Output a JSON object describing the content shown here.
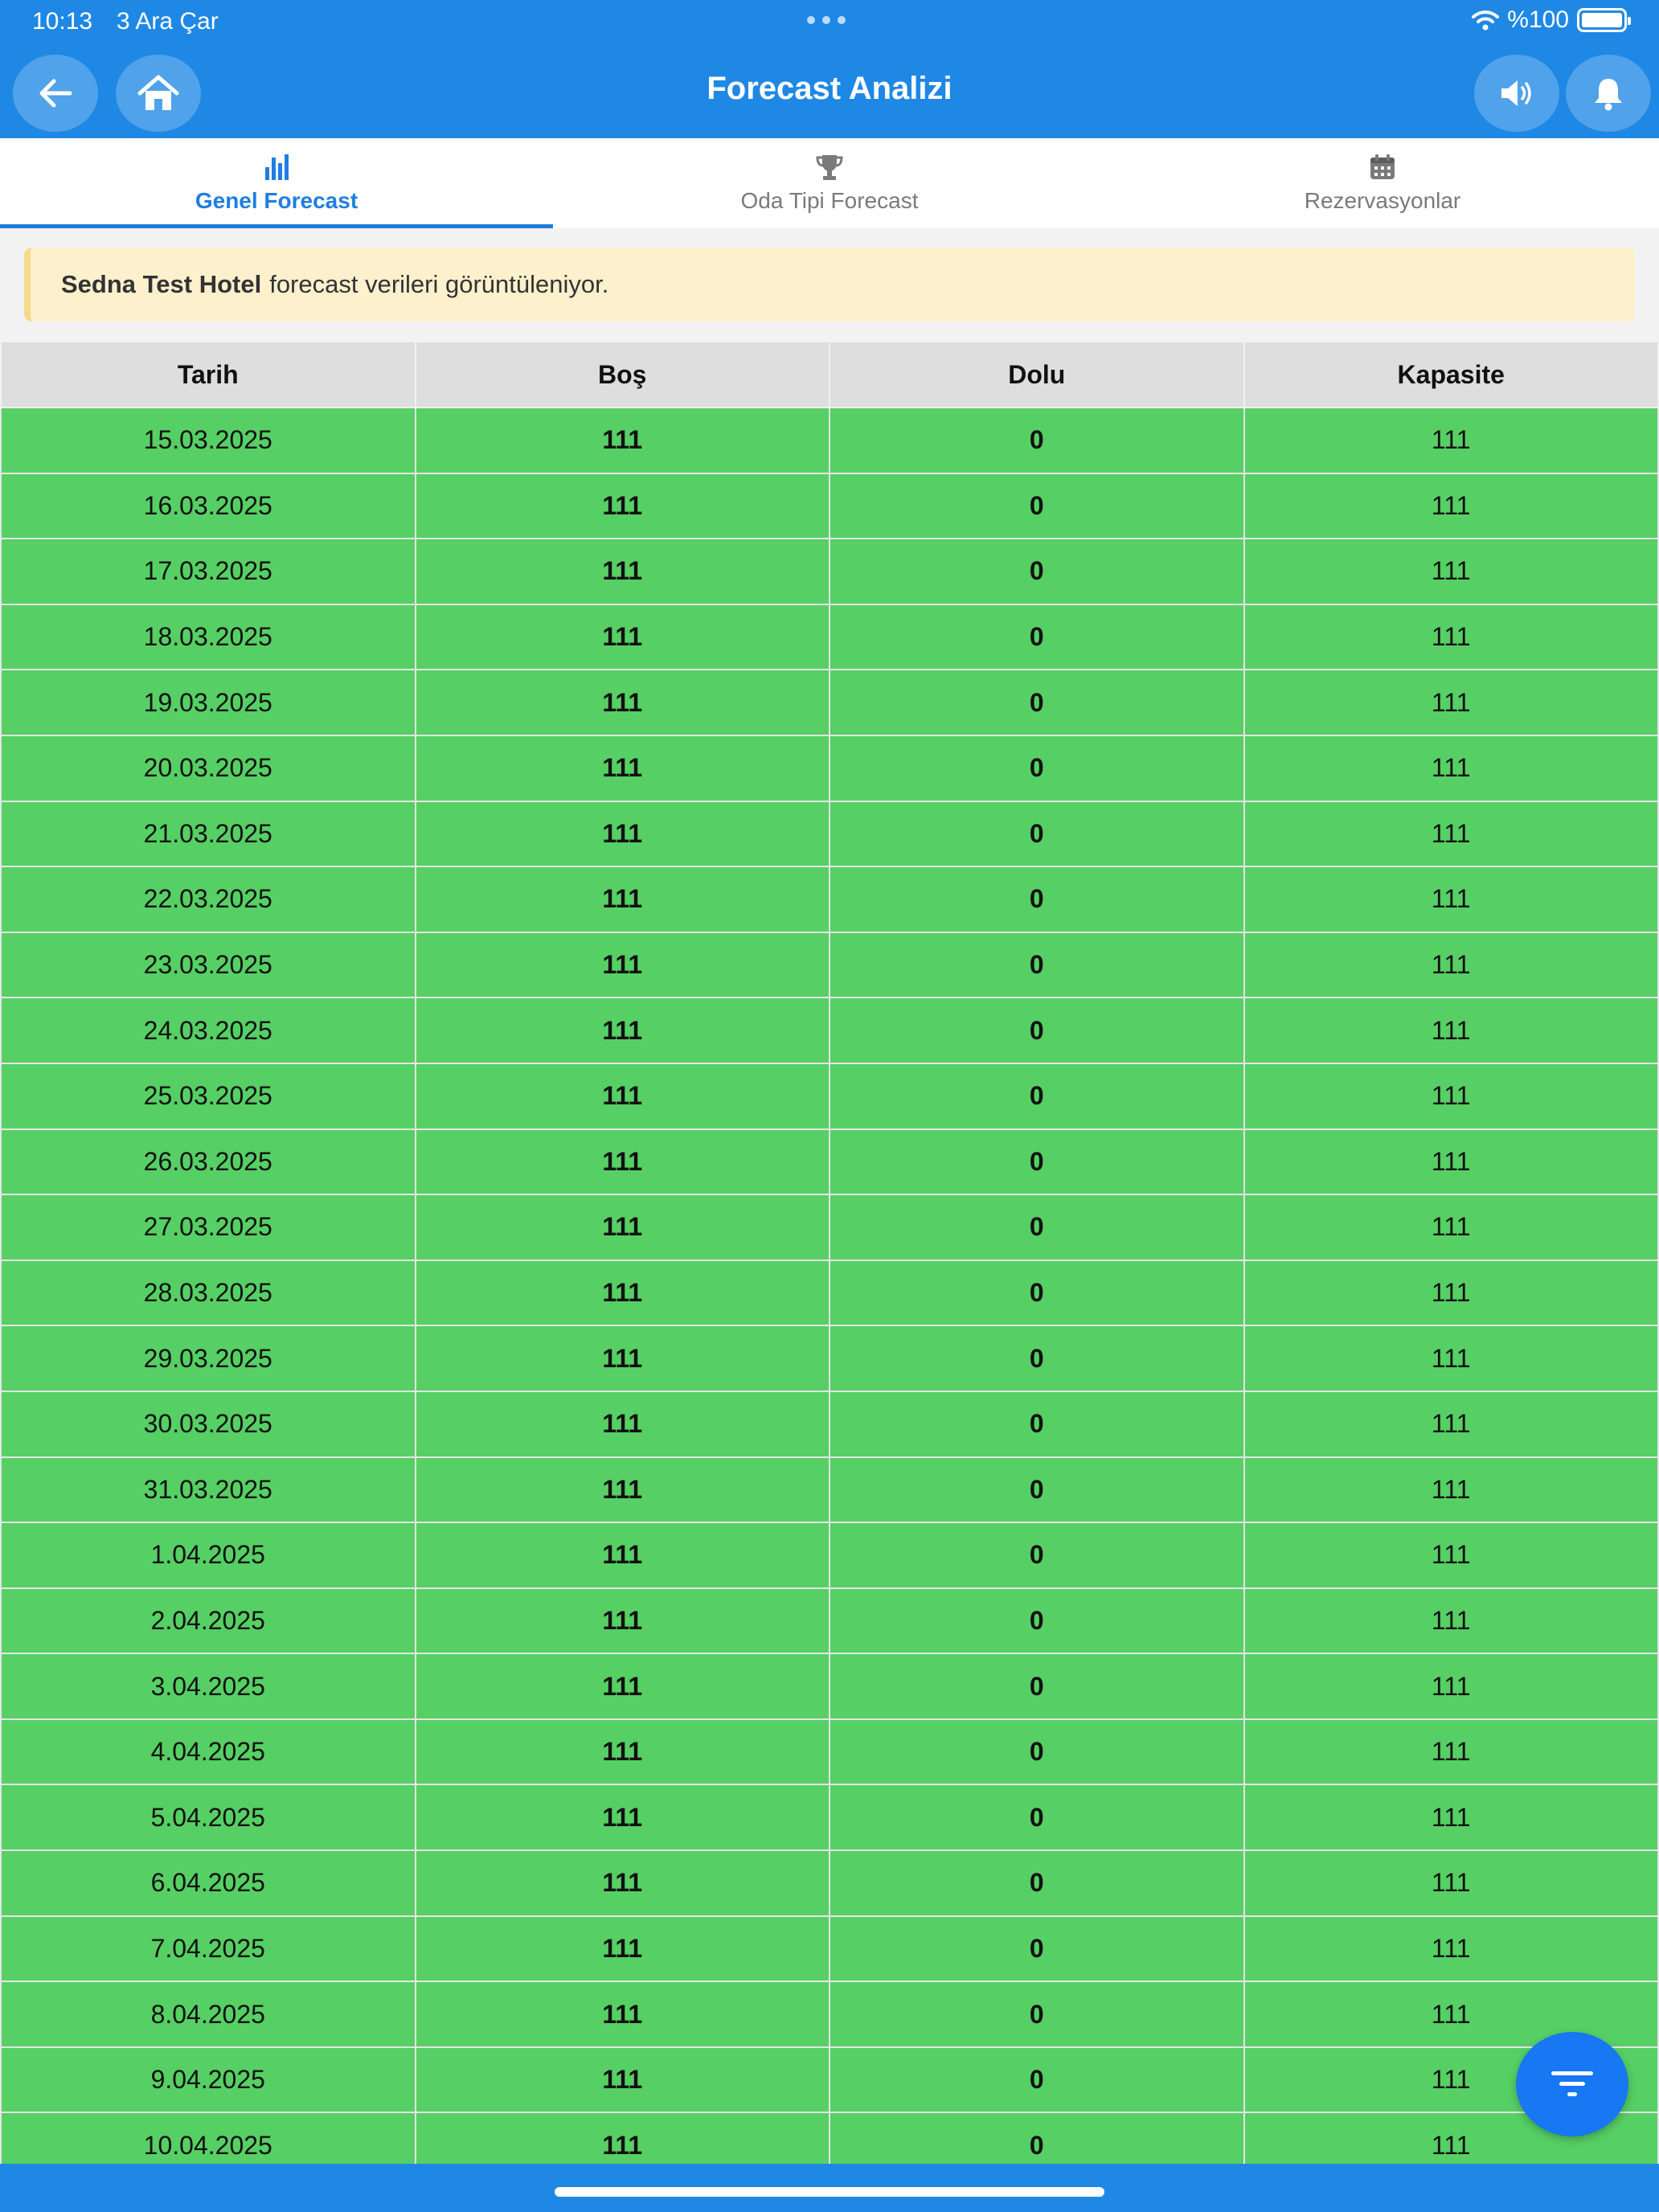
{
  "status_bar": {
    "time": "10:13",
    "date": "3 Ara Çar",
    "battery": "%100"
  },
  "header": {
    "title": "Forecast Analizi"
  },
  "tabs": [
    {
      "label": "Genel Forecast",
      "icon": "bar-chart-icon",
      "active": true
    },
    {
      "label": "Oda Tipi Forecast",
      "icon": "trophy-icon",
      "active": false
    },
    {
      "label": "Rezervasyonlar",
      "icon": "calendar-icon",
      "active": false
    }
  ],
  "banner": {
    "hotel": "Sedna Test Hotel",
    "text": "forecast verileri görüntüleniyor."
  },
  "table": {
    "headers": [
      "Tarih",
      "Boş",
      "Dolu",
      "Kapasite"
    ],
    "rows": [
      [
        "15.03.2025",
        "111",
        "0",
        "111"
      ],
      [
        "16.03.2025",
        "111",
        "0",
        "111"
      ],
      [
        "17.03.2025",
        "111",
        "0",
        "111"
      ],
      [
        "18.03.2025",
        "111",
        "0",
        "111"
      ],
      [
        "19.03.2025",
        "111",
        "0",
        "111"
      ],
      [
        "20.03.2025",
        "111",
        "0",
        "111"
      ],
      [
        "21.03.2025",
        "111",
        "0",
        "111"
      ],
      [
        "22.03.2025",
        "111",
        "0",
        "111"
      ],
      [
        "23.03.2025",
        "111",
        "0",
        "111"
      ],
      [
        "24.03.2025",
        "111",
        "0",
        "111"
      ],
      [
        "25.03.2025",
        "111",
        "0",
        "111"
      ],
      [
        "26.03.2025",
        "111",
        "0",
        "111"
      ],
      [
        "27.03.2025",
        "111",
        "0",
        "111"
      ],
      [
        "28.03.2025",
        "111",
        "0",
        "111"
      ],
      [
        "29.03.2025",
        "111",
        "0",
        "111"
      ],
      [
        "30.03.2025",
        "111",
        "0",
        "111"
      ],
      [
        "31.03.2025",
        "111",
        "0",
        "111"
      ],
      [
        "1.04.2025",
        "111",
        "0",
        "111"
      ],
      [
        "2.04.2025",
        "111",
        "0",
        "111"
      ],
      [
        "3.04.2025",
        "111",
        "0",
        "111"
      ],
      [
        "4.04.2025",
        "111",
        "0",
        "111"
      ],
      [
        "5.04.2025",
        "111",
        "0",
        "111"
      ],
      [
        "6.04.2025",
        "111",
        "0",
        "111"
      ],
      [
        "7.04.2025",
        "111",
        "0",
        "111"
      ],
      [
        "8.04.2025",
        "111",
        "0",
        "111"
      ],
      [
        "9.04.2025",
        "111",
        "0",
        "111"
      ],
      [
        "10.04.2025",
        "111",
        "0",
        "111"
      ]
    ]
  },
  "colors": {
    "header_blue": "#1f88e5",
    "row_green": "#56cf64",
    "active_tab": "#1f7ee0",
    "fab_blue": "#1877f2"
  }
}
